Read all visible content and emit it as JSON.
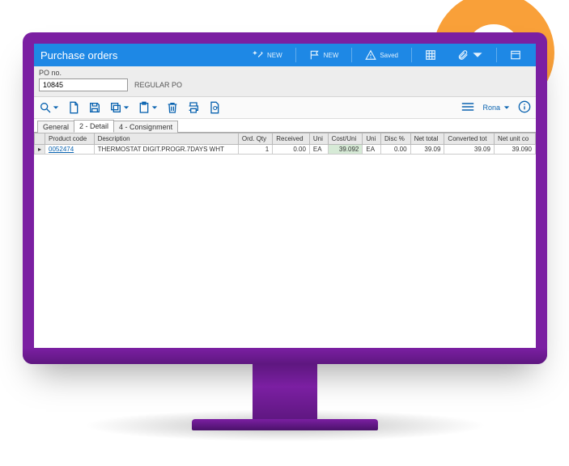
{
  "titlebar": {
    "title": "Purchase orders",
    "action1_label": "NEW",
    "action2_label": "NEW",
    "action3_label": "Saved"
  },
  "po": {
    "label": "PO no.",
    "value": "10845",
    "type": "REGULAR PO"
  },
  "toolbar": {
    "account": "Rona"
  },
  "tabs": {
    "general": "General",
    "detail": "2 - Detail",
    "consignment": "4 - Consignment"
  },
  "grid": {
    "headers": {
      "product_code": "Product code",
      "description": "Description",
      "ord_qty": "Ord. Qty",
      "received": "Received",
      "uni1": "Uni",
      "cost_uni": "Cost/Uni",
      "uni2": "Uni",
      "disc": "Disc %",
      "net_total": "Net total",
      "converted_tot": "Converted tot",
      "net_unit_co": "Net unit co"
    },
    "rows": [
      {
        "product_code": "0052474",
        "description": "THERMOSTAT DIGIT.PROGR.7DAYS WHT",
        "ord_qty": "1",
        "received": "0.00",
        "uni1": "EA",
        "cost_uni": "39.092",
        "uni2": "EA",
        "disc": "0.00",
        "net_total": "39.09",
        "converted_tot": "39.09",
        "net_unit_co": "39.090"
      }
    ]
  }
}
